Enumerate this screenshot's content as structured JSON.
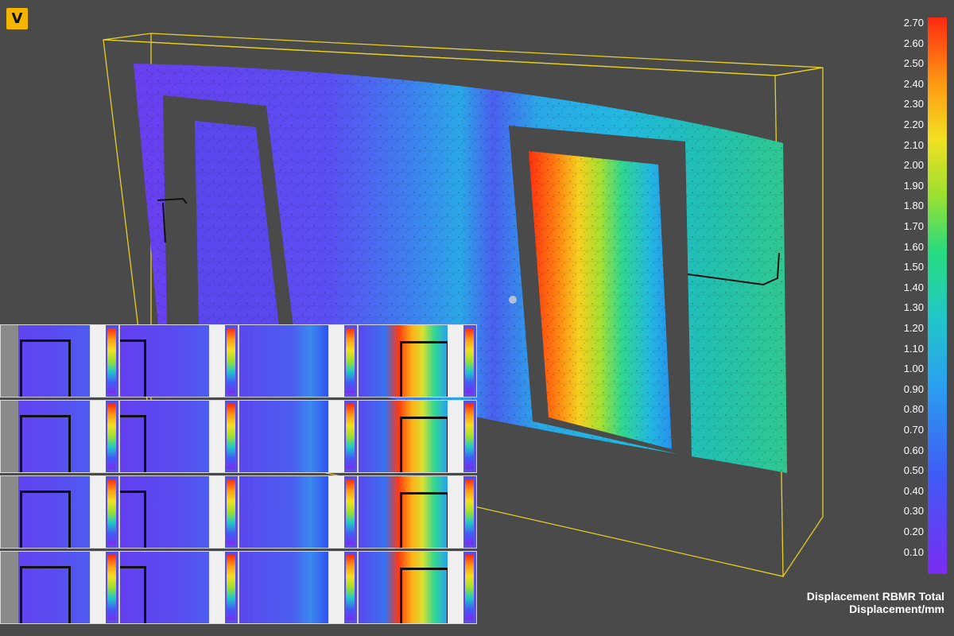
{
  "app": {
    "logo_letter": "V"
  },
  "legend": {
    "ticks": [
      "2.70",
      "2.60",
      "2.50",
      "2.40",
      "2.30",
      "2.20",
      "2.10",
      "2.00",
      "1.90",
      "1.80",
      "1.70",
      "1.60",
      "1.50",
      "1.40",
      "1.30",
      "1.20",
      "1.10",
      "1.00",
      "0.90",
      "0.80",
      "0.70",
      "0.60",
      "0.50",
      "0.40",
      "0.30",
      "0.20",
      "0.10"
    ],
    "title_line1": "Displacement RBMR Total",
    "title_line2": "Displacement/mm",
    "colors": {
      "min": "#7b2cf2",
      "low": "#3f5cf5",
      "mid_low": "#21c6c8",
      "mid": "#27dc7e",
      "mid_high": "#f1e022",
      "high": "#ff9a12",
      "max": "#ff2a10"
    }
  },
  "thumbnail_grid": {
    "rows": 4,
    "cols": 4,
    "highlight": [
      [
        0.0,
        0.05,
        0.25,
        0.85
      ],
      [
        0.0,
        0.05,
        0.25,
        0.85
      ],
      [
        0.0,
        0.05,
        0.2,
        0.7
      ],
      [
        0.0,
        0.05,
        0.2,
        0.8
      ]
    ]
  }
}
